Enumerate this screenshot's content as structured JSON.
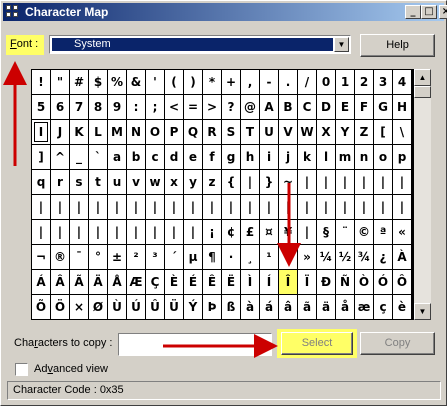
{
  "window": {
    "title": "Character Map",
    "icon": "character-map-icon"
  },
  "titlebar_buttons": {
    "minimize": "_",
    "maximize": "□",
    "close": "×"
  },
  "font": {
    "label": "Font :",
    "label_accel": "F",
    "label_rest": "ont :",
    "selected": "System"
  },
  "help_label": "Help",
  "grid": {
    "rows": [
      [
        "!",
        "\"",
        "#",
        "$",
        "%",
        "&",
        "'",
        "(",
        ")",
        "*",
        "+",
        ",",
        "-",
        ".",
        "/",
        "0",
        "1",
        "2",
        "3",
        "4"
      ],
      [
        "5",
        "6",
        "7",
        "8",
        "9",
        ":",
        ";",
        "<",
        "=",
        ">",
        "?",
        "@",
        "A",
        "B",
        "C",
        "D",
        "E",
        "F",
        "G",
        "H"
      ],
      [
        "I",
        "J",
        "K",
        "L",
        "M",
        "N",
        "O",
        "P",
        "Q",
        "R",
        "S",
        "T",
        "U",
        "V",
        "W",
        "X",
        "Y",
        "Z",
        "[",
        "\\"
      ],
      [
        "]",
        "^",
        "_",
        "`",
        "a",
        "b",
        "c",
        "d",
        "e",
        "f",
        "g",
        "h",
        "i",
        "j",
        "k",
        "l",
        "m",
        "n",
        "o",
        "p"
      ],
      [
        "q",
        "r",
        "s",
        "t",
        "u",
        "v",
        "w",
        "x",
        "y",
        "z",
        "{",
        "|",
        "}",
        "~",
        "|",
        "|",
        "|",
        "|",
        "|",
        "|"
      ],
      [
        "|",
        "|",
        "|",
        "|",
        "|",
        "|",
        "|",
        "|",
        "|",
        "|",
        "|",
        "|",
        "|",
        "|",
        "|",
        "|",
        "|",
        "|",
        "|",
        "|"
      ],
      [
        "|",
        "|",
        "|",
        "|",
        "|",
        "|",
        "|",
        "|",
        "|",
        "¡",
        "¢",
        "£",
        "¤",
        "¥",
        "|",
        "§",
        "¨",
        "©",
        "ª",
        "«"
      ],
      [
        "¬",
        "®",
        "¯",
        "°",
        "±",
        "²",
        "³",
        "´",
        "µ",
        "¶",
        "·",
        "¸",
        "¹",
        "º",
        "»",
        "¼",
        "½",
        "¾",
        "¿",
        "À"
      ],
      [
        "Á",
        "Â",
        "Ã",
        "Ä",
        "Å",
        "Æ",
        "Ç",
        "È",
        "É",
        "Ê",
        "Ë",
        "Ì",
        "Í",
        "Î",
        "Ï",
        "Ð",
        "Ñ",
        "Ò",
        "Ó",
        "Ô"
      ],
      [
        "Õ",
        "Ö",
        "×",
        "Ø",
        "Ù",
        "Ú",
        "Û",
        "Ü",
        "Ý",
        "Þ",
        "ß",
        "à",
        "á",
        "â",
        "ã",
        "ä",
        "å",
        "æ",
        "ç",
        "è"
      ]
    ],
    "selected_cell": [
      2,
      0
    ],
    "highlighted_cell": [
      8,
      13
    ],
    "highlight_color": "#ffff66"
  },
  "copy": {
    "label_before": "Cha",
    "label_accel": "r",
    "label_after": "acters to copy :",
    "value": ""
  },
  "select_label": "Select",
  "copy_label": "Copy",
  "advanced": {
    "accel": "v",
    "before": "Ad",
    "after": "anced view",
    "checked": false
  },
  "status": {
    "text": "Character Code : 0x35"
  },
  "annotation_colors": {
    "arrow": "#cc0000",
    "highlight": "#ffff66"
  }
}
